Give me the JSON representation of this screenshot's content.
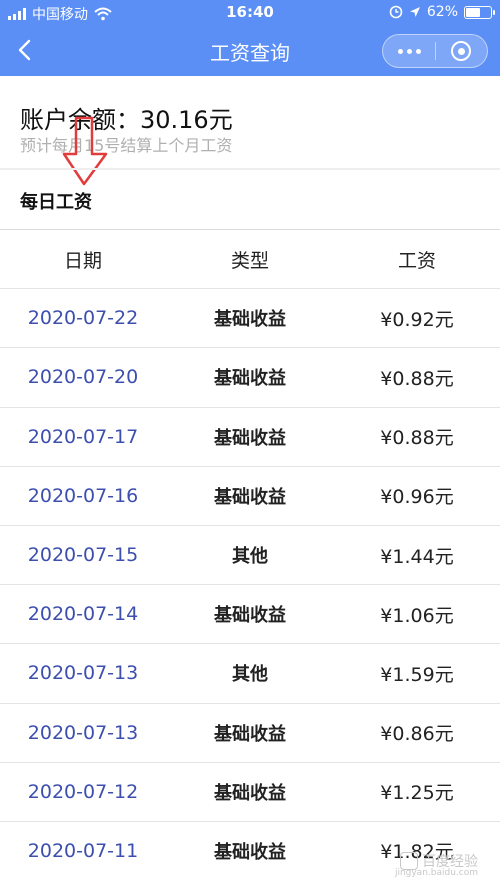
{
  "status_bar": {
    "carrier": "中国移动",
    "time": "16:40",
    "battery": "62%",
    "battery_level": 0.62,
    "icons": [
      "signal-icon",
      "wifi-icon",
      "alarm-icon",
      "location-icon",
      "charging-icon"
    ]
  },
  "nav": {
    "title": "工资查询",
    "back_icon": "chevron-left-icon",
    "more_icon": "more-dots-icon",
    "close_icon": "record-circle-icon"
  },
  "account": {
    "balance": "账户余额：30.16元",
    "note": "预计每月15号结算上个月工资"
  },
  "section_title": "每日工资",
  "table": {
    "headers": [
      "日期",
      "类型",
      "工资"
    ],
    "rows": [
      {
        "date": "2020-07-22",
        "type": "基础收益",
        "wage": "¥0.92元"
      },
      {
        "date": "2020-07-20",
        "type": "基础收益",
        "wage": "¥0.88元"
      },
      {
        "date": "2020-07-17",
        "type": "基础收益",
        "wage": "¥0.88元"
      },
      {
        "date": "2020-07-16",
        "type": "基础收益",
        "wage": "¥0.96元"
      },
      {
        "date": "2020-07-15",
        "type": "其他",
        "wage": "¥1.44元"
      },
      {
        "date": "2020-07-14",
        "type": "基础收益",
        "wage": "¥1.06元"
      },
      {
        "date": "2020-07-13",
        "type": "其他",
        "wage": "¥1.59元"
      },
      {
        "date": "2020-07-13",
        "type": "基础收益",
        "wage": "¥0.86元"
      },
      {
        "date": "2020-07-12",
        "type": "基础收益",
        "wage": "¥1.25元"
      },
      {
        "date": "2020-07-11",
        "type": "基础收益",
        "wage": "¥1.82元"
      }
    ]
  },
  "watermark": {
    "text": "百度经验",
    "url_text": "jingyan.baidu.com"
  },
  "colors": {
    "header_blue": "#5b8ff5",
    "date_blue": "#3d4fae",
    "annotation_red": "#e23b3b"
  }
}
